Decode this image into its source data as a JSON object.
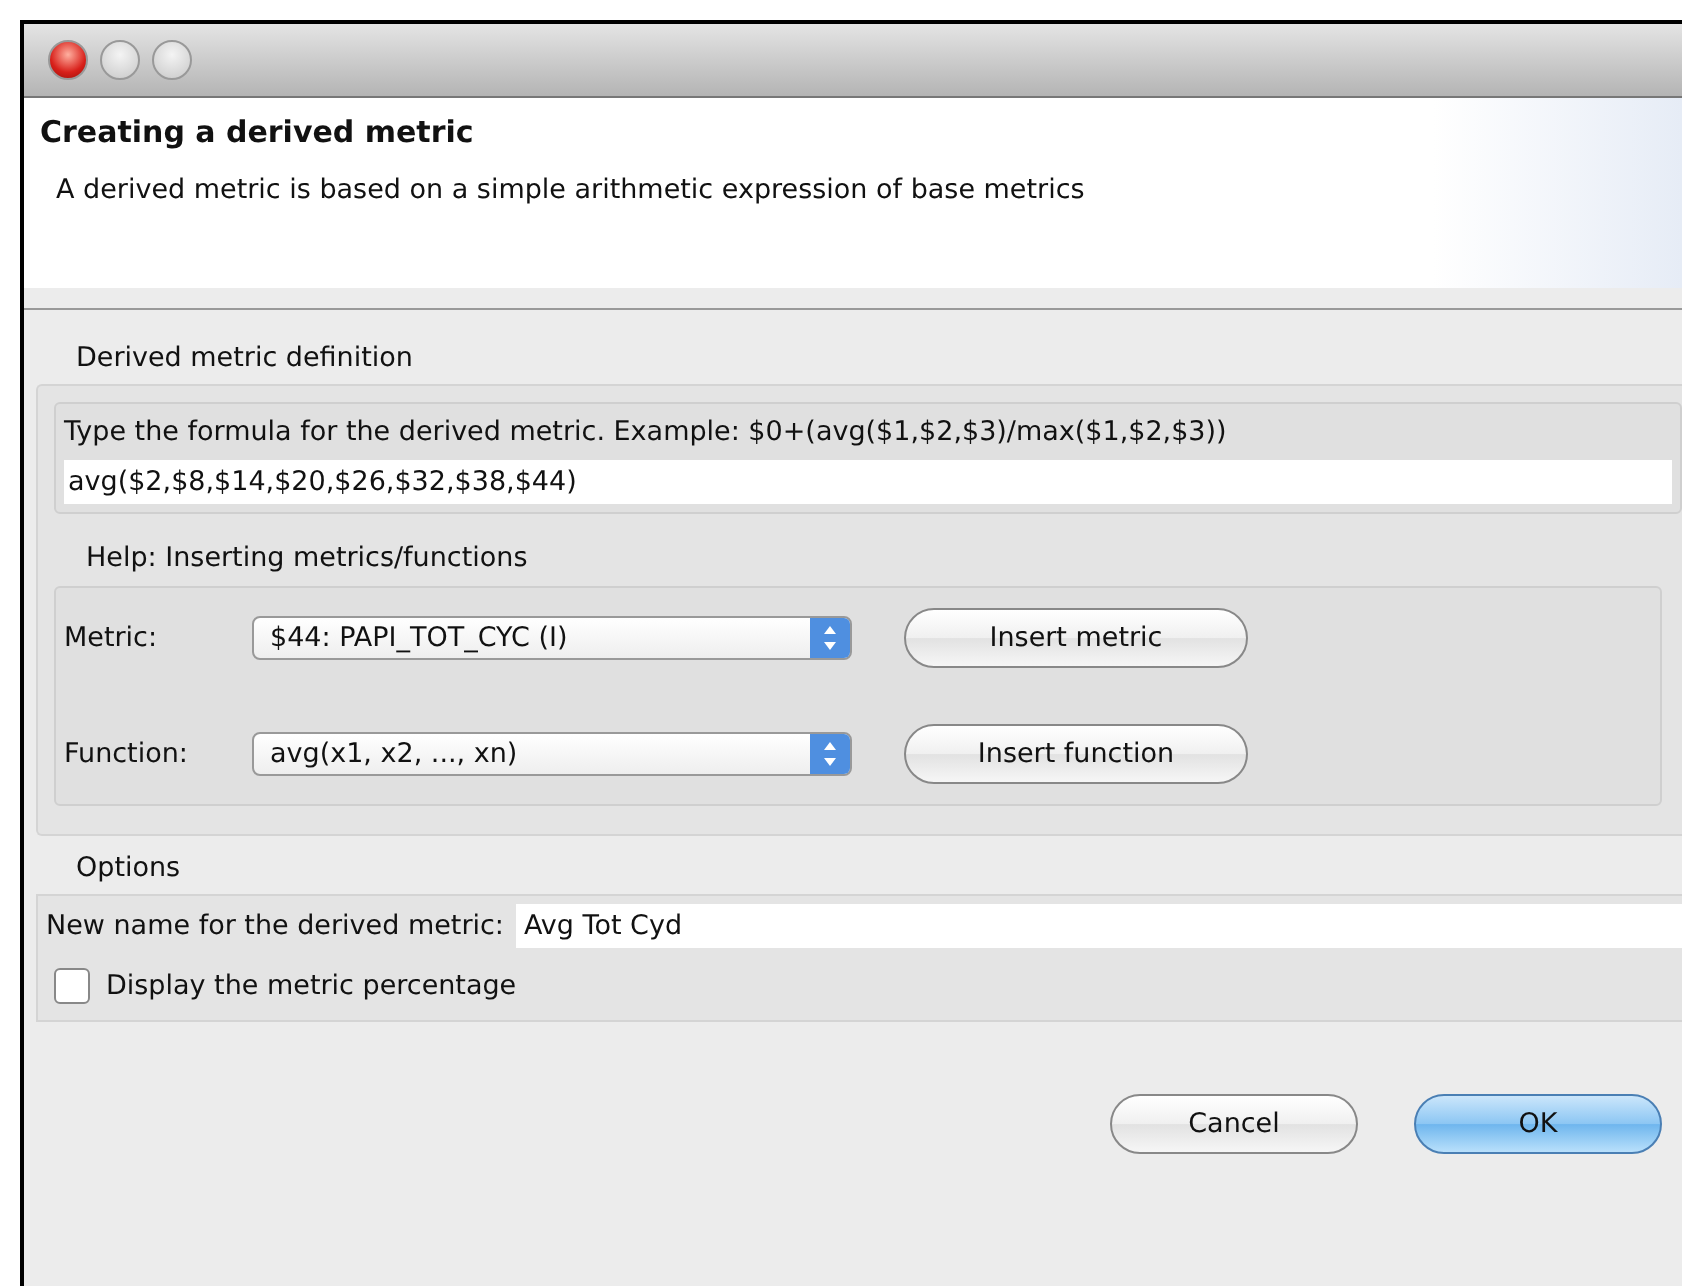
{
  "window": {
    "controls": [
      {
        "kind": "close"
      },
      {
        "kind": "minimize"
      },
      {
        "kind": "zoom"
      }
    ]
  },
  "header": {
    "title": "Creating a derived metric",
    "description": "A derived metric is based on a simple arithmetic expression of base metrics"
  },
  "definition": {
    "label": "Derived metric definition",
    "instruction": "Type the formula for the derived metric. Example: $0+(avg($1,$2,$3)/max($1,$2,$3))",
    "formula": "avg($2,$8,$14,$20,$26,$32,$38,$44)",
    "help": {
      "label": "Help: Inserting metrics/functions",
      "rows": [
        {
          "label": "Metric:",
          "value": "$44: PAPI_TOT_CYC (I)",
          "button": "Insert metric"
        },
        {
          "label": "Function:",
          "value": "avg(x1, x2, ..., xn)",
          "button": "Insert function"
        }
      ]
    }
  },
  "options": {
    "label": "Options",
    "name_label": "New name for the derived metric:",
    "name_value": "Avg Tot Cyd",
    "checkbox": {
      "label": "Display the metric percentage",
      "checked": false
    }
  },
  "buttons": [
    {
      "label": "Cancel",
      "default": false
    },
    {
      "label": "OK",
      "default": true
    }
  ]
}
